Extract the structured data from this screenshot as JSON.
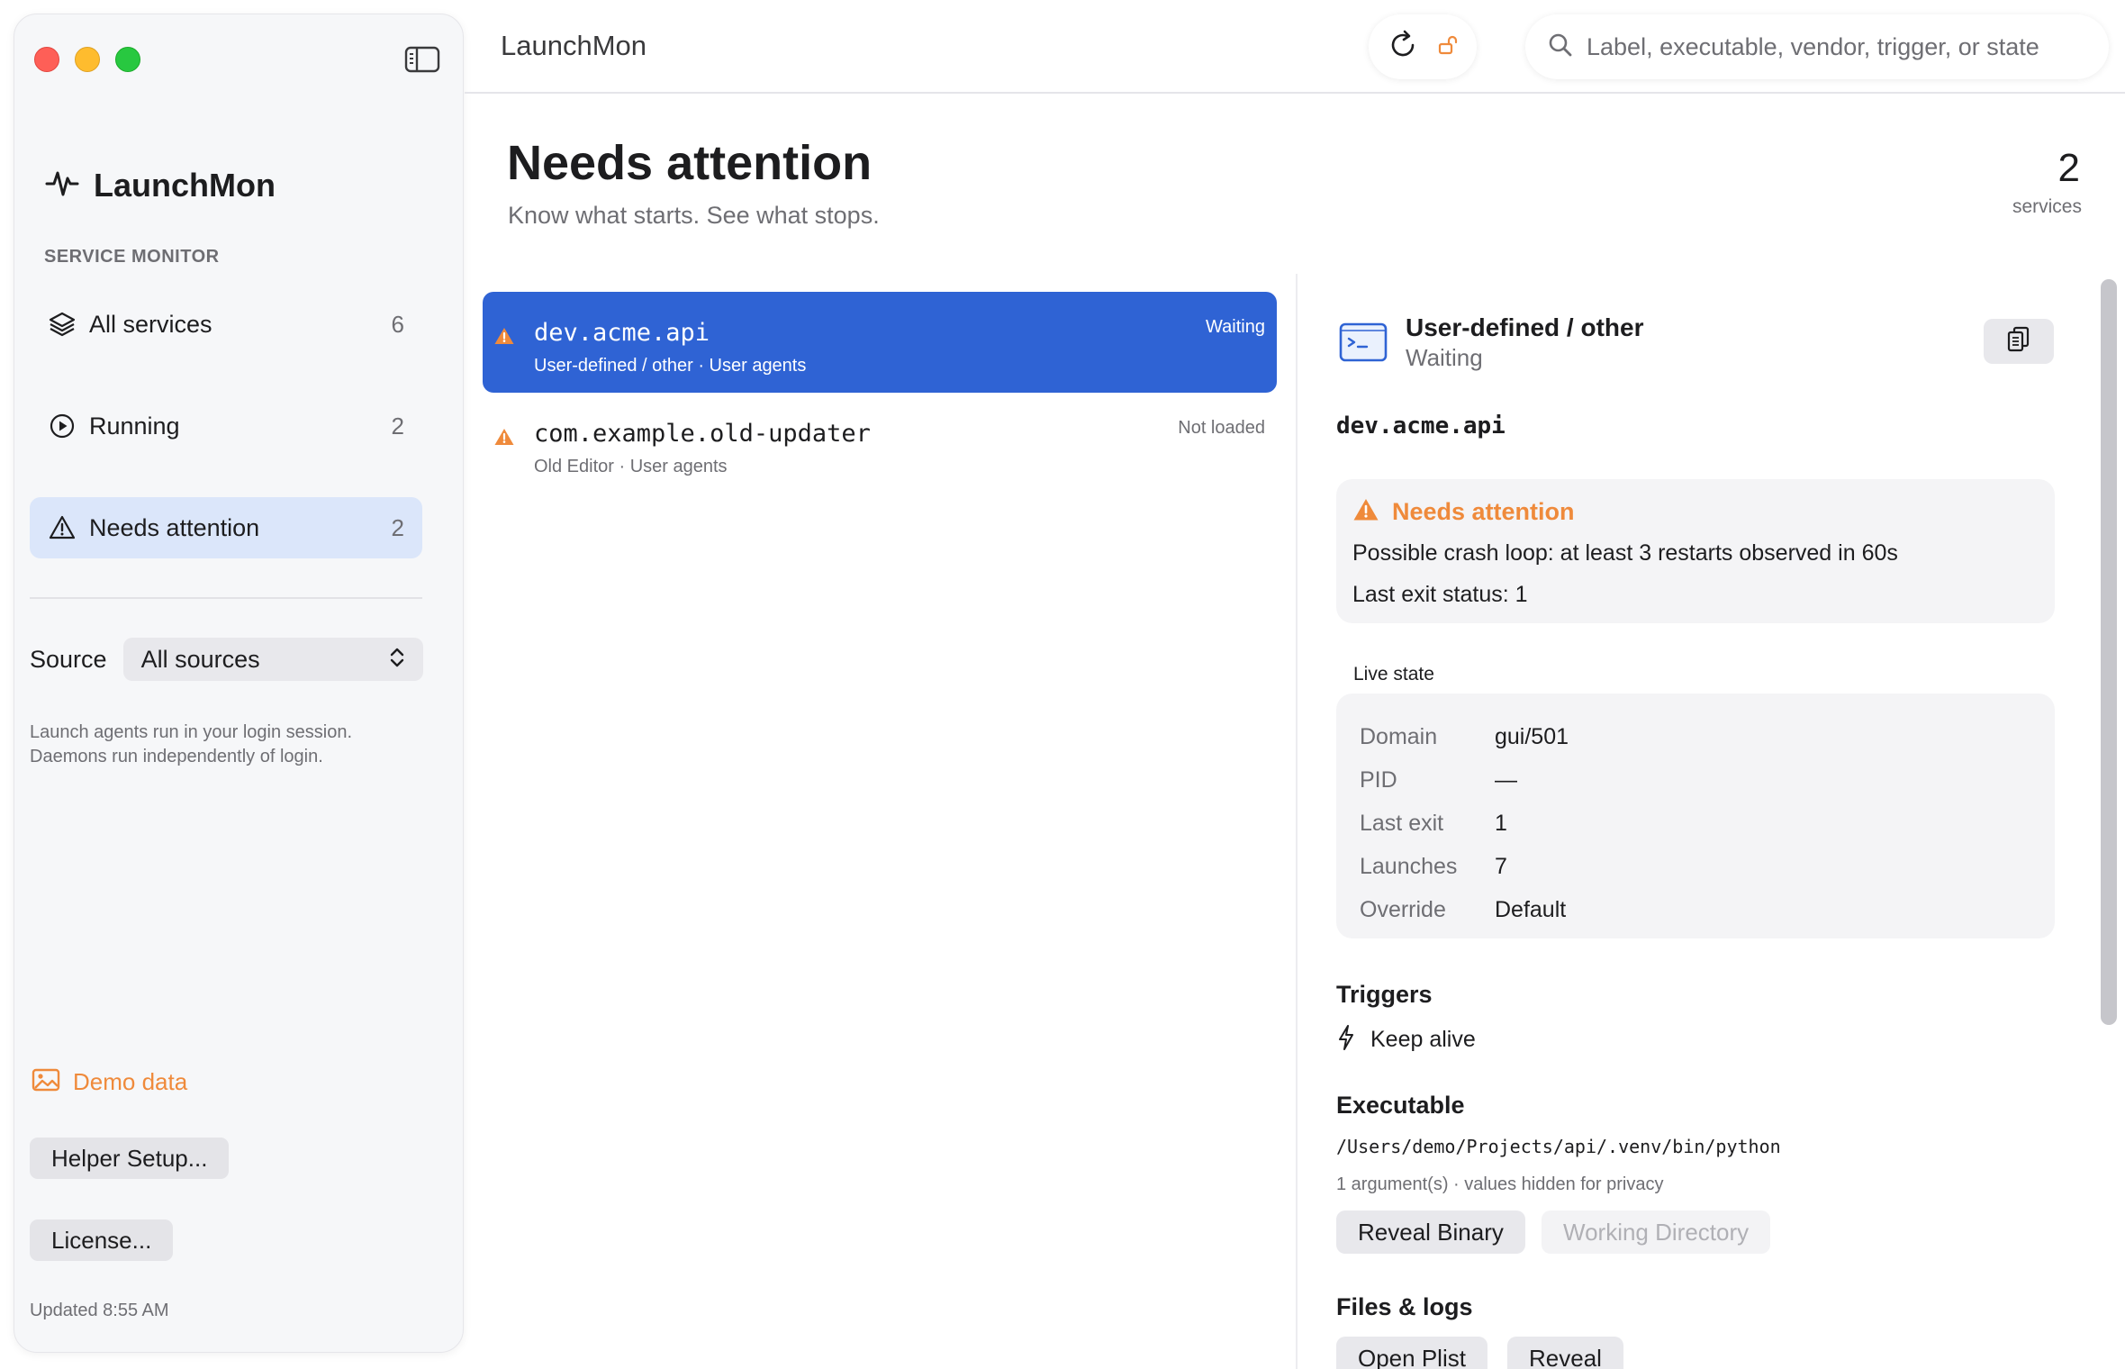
{
  "window": {
    "title": "LaunchMon"
  },
  "sidebar": {
    "brand": "LaunchMon",
    "section": "SERVICE MONITOR",
    "items": [
      {
        "label": "All services",
        "count": "6"
      },
      {
        "label": "Running",
        "count": "2"
      },
      {
        "label": "Needs attention",
        "count": "2"
      }
    ],
    "source": {
      "label": "Source",
      "value": "All sources"
    },
    "hint": "Launch agents run in your login session. Daemons run independently of login.",
    "demo": "Demo data",
    "helper_button": "Helper Setup...",
    "license_button": "License...",
    "updated": "Updated 8:55 AM"
  },
  "toolbar": {
    "search_placeholder": "Label, executable, vendor, trigger, or state"
  },
  "header": {
    "title": "Needs attention",
    "subtitle": "Know what starts. See what stops.",
    "count": "2",
    "count_label": "services"
  },
  "list": [
    {
      "name": "dev.acme.api",
      "sub": "User-defined / other · User agents",
      "state": "Waiting"
    },
    {
      "name": "com.example.old-updater",
      "sub": "Old Editor · User agents",
      "state": "Not loaded"
    }
  ],
  "detail": {
    "kind": "User-defined / other",
    "state": "Waiting",
    "label": "dev.acme.api",
    "attention": {
      "title": "Needs attention",
      "line1": "Possible crash loop: at least 3 restarts observed in 60s",
      "line2": "Last exit status: 1"
    },
    "live_state": {
      "title": "Live state",
      "rows": [
        {
          "k": "Domain",
          "v": "gui/501"
        },
        {
          "k": "PID",
          "v": "—"
        },
        {
          "k": "Last exit",
          "v": "1"
        },
        {
          "k": "Launches",
          "v": "7"
        },
        {
          "k": "Override",
          "v": "Default"
        }
      ]
    },
    "triggers": {
      "title": "Triggers",
      "items": [
        "Keep alive"
      ]
    },
    "executable": {
      "title": "Executable",
      "path": "/Users/demo/Projects/api/.venv/bin/python",
      "args": "1 argument(s) · values hidden for privacy",
      "reveal_binary": "Reveal Binary",
      "working_directory": "Working Directory"
    },
    "files": {
      "title": "Files & logs",
      "open_plist": "Open Plist",
      "reveal": "Reveal"
    }
  },
  "colors": {
    "accent": "#2f63d4",
    "warning": "#ef8a3b",
    "active_nav": "#dbe6fa"
  }
}
